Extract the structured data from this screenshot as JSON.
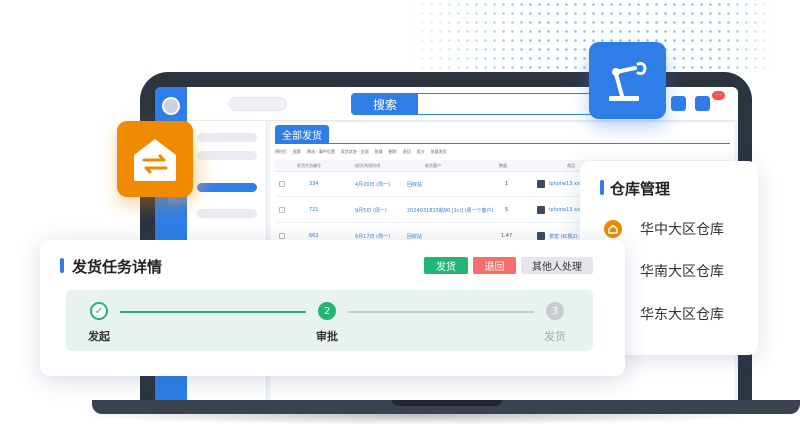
{
  "search": {
    "button_label": "搜索"
  },
  "badge_text": "···",
  "screen": {
    "tab_label": "全部发货",
    "toolbar_items": [
      "预约打",
      "搜索",
      "筛选 · 事件位置",
      "发货状态 · 全部",
      "批量",
      "删除",
      "退回",
      "组分",
      "批量发货"
    ],
    "table_headers": [
      "发货任务编号",
      "成功/失败时间",
      "收货客户",
      "数量",
      "商品",
      "仓库"
    ],
    "rows": [
      {
        "id": "334",
        "date": "4月20日 (周一)",
        "customer": "回收站",
        "qty": "1",
        "product": "iphone13 xxxx"
      },
      {
        "id": "721",
        "date": "9月5日 (周一)",
        "customer": "2024031815點90 [1cl] (周一个客户)",
        "qty": "5",
        "product": "iphone13 xxxx"
      },
      {
        "id": "662",
        "date": "6月17日 (周一)",
        "customer": "回收站",
        "qty": "1.47",
        "product": "茶宏 (红枫2)"
      }
    ]
  },
  "warehouse": {
    "title": "仓库管理",
    "items": [
      {
        "label": "华中大区仓库"
      },
      {
        "label": "华南大区仓库"
      },
      {
        "label": "华东大区仓库"
      }
    ]
  },
  "task": {
    "title": "发货任务详情",
    "buttons": {
      "ship": "发货",
      "return": "退回",
      "other": "其他人处理"
    },
    "steps": [
      {
        "num": "✓",
        "label": "发起",
        "status": "done"
      },
      {
        "num": "2",
        "label": "审批",
        "status": "active"
      },
      {
        "num": "3",
        "label": "发货",
        "status": "pending"
      }
    ]
  },
  "colors": {
    "primary": "#2f7ee8",
    "orange": "#f08a00",
    "green": "#22b573",
    "red": "#f46f6b"
  }
}
